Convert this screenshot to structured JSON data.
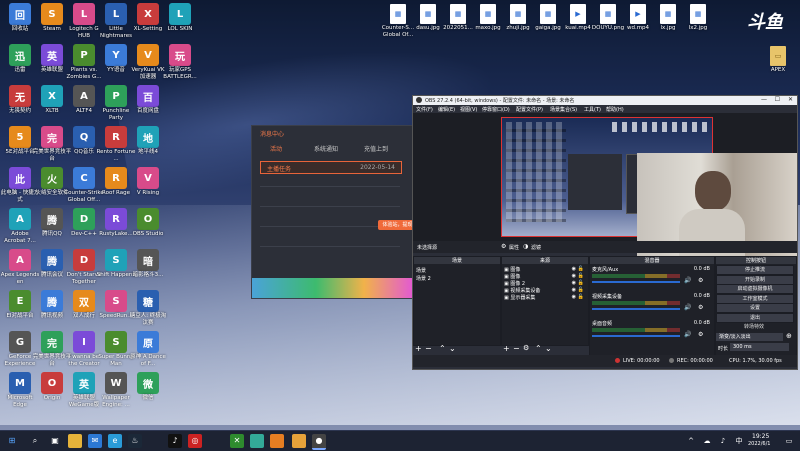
{
  "desktop": {
    "col1": [
      "回收站",
      "迅雷",
      "无畏契约",
      "5E对战平台",
      "此电脑 - 快捷方式",
      "Adobe Acrobat 7...",
      "Apex Legends en",
      "EI对战平台",
      "GeForce Experience",
      "Microsoft Edge"
    ],
    "col2": [
      "Steam",
      "英雄联盟",
      "XLTB",
      "完美世界竞技平台",
      "火绒安全软件",
      "腾讯QQ",
      "腾讯会议",
      "腾讯视频",
      "完美世界竞技平台",
      "Origin"
    ],
    "col3": [
      "Logitech G HUB",
      "Plants vs. Zombies G...",
      "ALTF4",
      "QQ音乐",
      "Counter-Strike Global Off...",
      "Dev-C++",
      "Don't Starve Together",
      "双人成行",
      "I wanna be the Creator",
      "英雄联盟 WeGame版"
    ],
    "col4": [
      "Little Nightmares",
      "YY语音",
      "Punchline Party",
      "Rento Fortune ...",
      "Roof Rage",
      "RustyLake...",
      "Shift Happens",
      "SpeedRun...",
      "Super Bunny Man",
      "Wallpaper Engine: ..."
    ],
    "col5": [
      "XL-Setting",
      "VeryKuai VK 加速器",
      "百度网盘",
      "地平线4",
      "V Rising",
      "OBS Studio",
      "暗影格斗3...",
      "糖豆人: 终极淘汰赛",
      "原神 A Dance of F...",
      "微信"
    ],
    "col6": [
      "LOL SKIN",
      "玩家GPS BATTLEGR..."
    ],
    "files": [
      "Counter-S... Global Of...",
      "dasu.jpg",
      "2022051...",
      "maxo.jpg",
      "zhuji.jpg",
      "gaiga.jpg",
      "kuai.mp4",
      "DOUYU.png",
      "wd.mp4",
      "lx.jpg",
      "lx2.jpg"
    ],
    "right_file": "APEX"
  },
  "douyu_logo": "斗鱼",
  "message_window": {
    "title": "消息中心",
    "tabs": [
      "活动",
      "系统通知",
      "充值上到"
    ],
    "item_title": "主播任务",
    "item_date": "2022-05-14",
    "tooltip": "体验站，提现说"
  },
  "obs": {
    "title": "OBS 27.2.4 (64-bit, windows) - 配置文件: 未命名 - 场景: 未命名",
    "menu": [
      "文件(F)",
      "编辑(E)",
      "视图(V)",
      "停靠窗口(D)",
      "配置文件(P)",
      "场景集合(S)",
      "工具(T)",
      "帮助(H)"
    ],
    "no_source": "未选择源",
    "props_button": "属性",
    "filter_button": "滤镜",
    "scenes_header": "场景",
    "scenes": [
      "场景",
      "场景 2"
    ],
    "sources_header": "来源",
    "sources": [
      "图像",
      "图像",
      "图像 2",
      "视频采集设备",
      "显示器采集"
    ],
    "mixer_header": "混音器",
    "mixer": [
      {
        "name": "麦克风/Aux",
        "level": "0.0 dB"
      },
      {
        "name": "视频采集设备",
        "level": "0.0 dB"
      },
      {
        "name": "桌面音频",
        "level": "0.0 dB"
      }
    ],
    "controls_header": "控制按钮",
    "controls": [
      "停止推流",
      "开始录制",
      "启动虚拟摄像机",
      "工作室模式",
      "设置",
      "退出"
    ],
    "transition_header": "转场特效",
    "transition": "渐变/淡入淡出",
    "duration_label": "时长",
    "duration": "300 ms",
    "status": {
      "live": "LIVE: 00:00:00",
      "rec": "REC: 00:00:00",
      "cpu": "CPU: 1.7%, 30.00 fps"
    }
  },
  "taskbar": {
    "time": "19:25",
    "date": "2022/6/1"
  }
}
